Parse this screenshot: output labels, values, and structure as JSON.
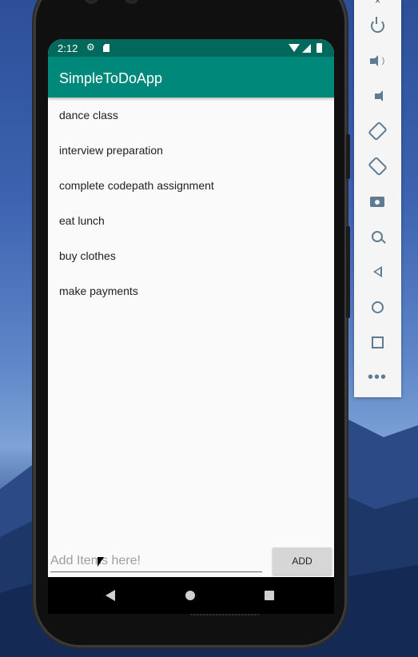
{
  "status_bar": {
    "time": "2:12",
    "icons": [
      "gear-icon",
      "sd-card-icon",
      "wifi-icon",
      "signal-icon",
      "battery-icon"
    ]
  },
  "app_bar": {
    "title": "SimpleToDoApp",
    "color": "#00897b",
    "status_color": "#00695c"
  },
  "todo_items": [
    "dance class",
    "interview preparation",
    "complete codepath assignment",
    "eat lunch",
    "buy clothes",
    "make payments"
  ],
  "add_item": {
    "placeholder": "Add Items here!",
    "button_label": "ADD"
  },
  "emulator_toolbar": {
    "buttons": [
      "power-icon",
      "volume-up-icon",
      "volume-down-icon",
      "rotate-left-icon",
      "rotate-right-icon",
      "screenshot-icon",
      "zoom-icon",
      "back-icon",
      "home-icon",
      "overview-icon",
      "more-icon"
    ]
  }
}
